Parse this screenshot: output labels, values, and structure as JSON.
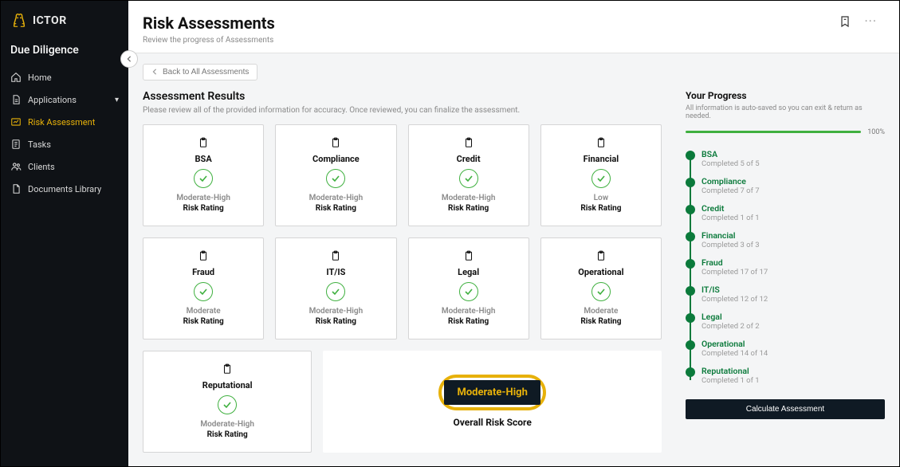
{
  "brand": {
    "name": "ICTOR"
  },
  "module": "Due Diligence",
  "sidebar": {
    "items": [
      {
        "label": "Home",
        "icon": "home-icon"
      },
      {
        "label": "Applications",
        "icon": "doc-icon",
        "expandable": true
      },
      {
        "label": "Risk Assessment",
        "icon": "assessment-icon",
        "active": true
      },
      {
        "label": "Tasks",
        "icon": "task-icon"
      },
      {
        "label": "Clients",
        "icon": "clients-icon"
      },
      {
        "label": "Documents Library",
        "icon": "library-icon"
      }
    ]
  },
  "header": {
    "title": "Risk Assessments",
    "subtitle": "Review the progress of Assessments"
  },
  "back_label": "Back to All Assessments",
  "results": {
    "title": "Assessment Results",
    "desc": "Please review all of the provided information for accuracy. Once reviewed, you can finalize the assessment.",
    "rating_label": "Risk Rating",
    "cards": [
      {
        "name": "BSA",
        "level": "Moderate-High"
      },
      {
        "name": "Compliance",
        "level": "Moderate-High"
      },
      {
        "name": "Credit",
        "level": "Moderate-High"
      },
      {
        "name": "Financial",
        "level": "Low"
      },
      {
        "name": "Fraud",
        "level": "Moderate"
      },
      {
        "name": "IT/IS",
        "level": "Moderate-High"
      },
      {
        "name": "Legal",
        "level": "Moderate-High"
      },
      {
        "name": "Operational",
        "level": "Moderate"
      },
      {
        "name": "Reputational",
        "level": "Moderate-High"
      }
    ]
  },
  "overall": {
    "badge": "Moderate-High",
    "label": "Overall Risk Score"
  },
  "progress": {
    "title": "Your Progress",
    "note": "All information is auto-saved so you can exit & return as needed.",
    "percent": "100%",
    "items": [
      {
        "name": "BSA",
        "completed": "Completed 5 of 5"
      },
      {
        "name": "Compliance",
        "completed": "Completed 7 of 7"
      },
      {
        "name": "Credit",
        "completed": "Completed 1 of 1"
      },
      {
        "name": "Financial",
        "completed": "Completed 3 of 3"
      },
      {
        "name": "Fraud",
        "completed": "Completed 17 of 17"
      },
      {
        "name": "IT/IS",
        "completed": "Completed 12 of 12"
      },
      {
        "name": "Legal",
        "completed": "Completed 2 of 2"
      },
      {
        "name": "Operational",
        "completed": "Completed 14 of 14"
      },
      {
        "name": "Reputational",
        "completed": "Completed 1 of 1"
      }
    ],
    "button": "Calculate Assessment"
  }
}
